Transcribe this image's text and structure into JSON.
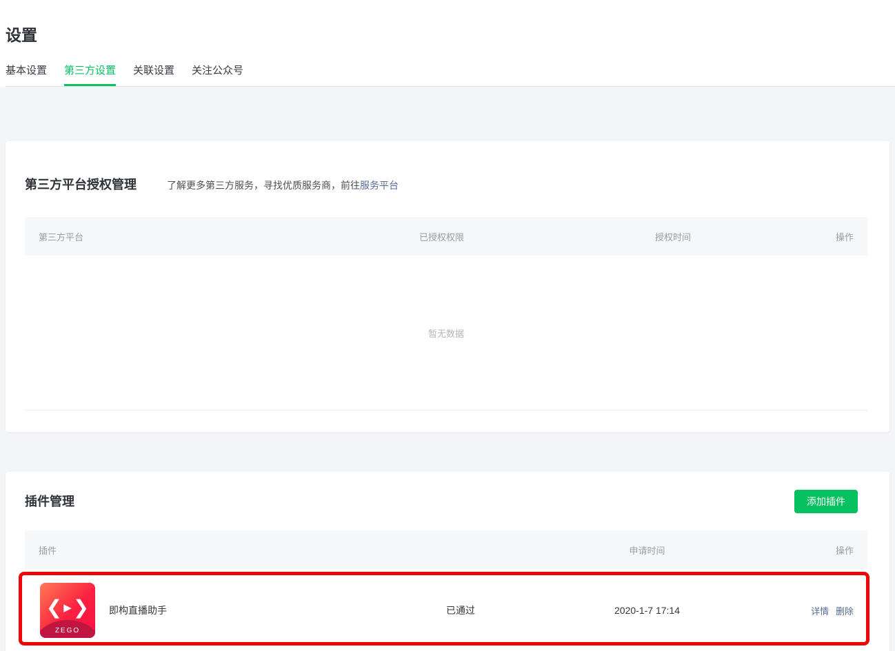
{
  "page": {
    "title": "设置"
  },
  "tabs": [
    {
      "label": "基本设置",
      "active": false
    },
    {
      "label": "第三方设置",
      "active": true
    },
    {
      "label": "关联设置",
      "active": false
    },
    {
      "label": "关注公众号",
      "active": false
    }
  ],
  "auth_section": {
    "title": "第三方平台授权管理",
    "desc_prefix": "了解更多第三方服务，寻找优质服务商，前往",
    "desc_link": "服务平台",
    "table": {
      "headers": [
        "第三方平台",
        "已授权权限",
        "授权时间",
        "操作"
      ],
      "empty_text": "暂无数据"
    }
  },
  "plugin_section": {
    "title": "插件管理",
    "add_button_label": "添加插件",
    "table": {
      "headers": [
        "插件",
        "",
        "申请时间",
        "操作"
      ]
    },
    "rows": [
      {
        "icon": "zego-logo-icon",
        "icon_text": "ZEGO",
        "name": "即构直播助手",
        "status": "已通过",
        "apply_time": "2020-1-7 17:14",
        "actions": {
          "detail": "详情",
          "delete": "删除"
        }
      }
    ]
  },
  "colors": {
    "accent_green": "#07c160",
    "link_blue": "#576b95",
    "annotation_red": "#ee0505",
    "zego_gradient_start": "#ff7a55",
    "zego_gradient_end": "#f50f46",
    "table_header_bg": "#f6f7f9",
    "page_bg": "#f4f5f7"
  }
}
